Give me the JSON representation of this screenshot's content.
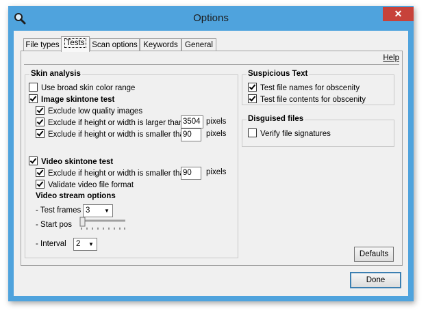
{
  "window": {
    "title": "Options",
    "close_glyph": "✕"
  },
  "tabs": [
    {
      "label": "File types"
    },
    {
      "label": "Tests"
    },
    {
      "label": "Scan options"
    },
    {
      "label": "Keywords"
    },
    {
      "label": "General"
    }
  ],
  "help_label": "Help",
  "skin_analysis": {
    "title": "Skin analysis",
    "broad_skin": {
      "label": "Use broad skin color range",
      "checked": false
    },
    "image_test": {
      "label": "Image skintone test",
      "checked": true,
      "low_quality": {
        "label": "Exclude low quality images",
        "checked": true
      },
      "larger_than": {
        "label": "Exclude if  height or width is larger than",
        "checked": true,
        "value": "3504",
        "unit": "pixels"
      },
      "smaller_than": {
        "label": "Exclude if height or width is smaller than",
        "checked": true,
        "value": "90",
        "unit": "pixels"
      }
    },
    "video_test": {
      "label": "Video skintone test",
      "checked": true,
      "smaller_than": {
        "label": "Exclude if height or width is smaller than",
        "checked": true,
        "value": "90",
        "unit": "pixels"
      },
      "validate": {
        "label": "Validate video file format",
        "checked": true
      }
    },
    "stream": {
      "title": "Video stream options",
      "test_frames_label": "- Test frames",
      "test_frames_value": "3",
      "start_pos_label": "- Start pos",
      "start_pos_level": 0,
      "interval_label": "- Interval",
      "interval_value": "2"
    }
  },
  "suspicious_text": {
    "title": "Suspicious Text",
    "names": {
      "label": "Test file names for obscenity",
      "checked": true
    },
    "contents": {
      "label": "Test file contents for obscenity",
      "checked": true
    }
  },
  "disguised_files": {
    "title": "Disguised files",
    "verify": {
      "label": "Verify file signatures",
      "checked": false
    }
  },
  "buttons": {
    "defaults": "Defaults",
    "done": "Done"
  },
  "colors": {
    "title_bar": "#4fa3dd",
    "close_button": "#c7423a",
    "client_bg": "#f0f0f0"
  }
}
